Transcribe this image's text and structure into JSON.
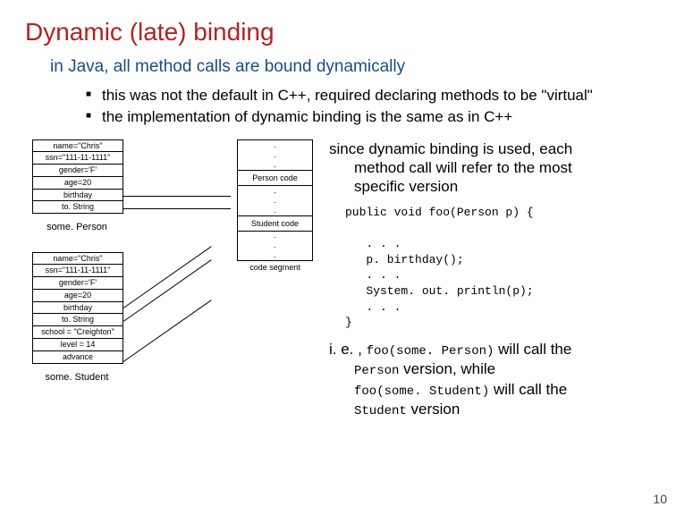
{
  "title": "Dynamic (late) binding",
  "subtitle": "in Java, all method calls are bound dynamically",
  "bullets": [
    "this was not the default in C++, required declaring methods to be \"virtual\"",
    "the implementation of dynamic binding is the same as in C++"
  ],
  "obj1": {
    "rows": [
      "name=\"Chris\"",
      "ssn=\"111-11-1111\"",
      "gender='F'",
      "age=20",
      "birthday",
      "to. String"
    ],
    "label": "some. Person"
  },
  "obj2": {
    "rows": [
      "name=\"Chris\"",
      "ssn=\"111-11-1111\"",
      "gender='F'",
      "age=20",
      "birthday",
      "to. String",
      "school = \"Creighton\"",
      "level = 14",
      "advance"
    ],
    "label": "some. Student"
  },
  "mem": {
    "seg1": "Person code",
    "seg2": "Student code",
    "seg3": "code segment"
  },
  "right1a": "since dynamic binding is used, each",
  "right1b": "method call will refer to the most",
  "right1c": "specific version",
  "code": "public void foo(Person p) {\n\n   . . .\n   p. birthday();\n   . . .\n   System. out. println(p);\n   . . .\n}",
  "concl_parts": {
    "a": "i. e. , ",
    "b": "foo(some. Person)",
    "c": " will call the",
    "d": "Person",
    "e": " version, while",
    "f": "foo(some. Student)",
    "g": " will call the",
    "h": "Student",
    "i": " version"
  },
  "slidenum": "10"
}
